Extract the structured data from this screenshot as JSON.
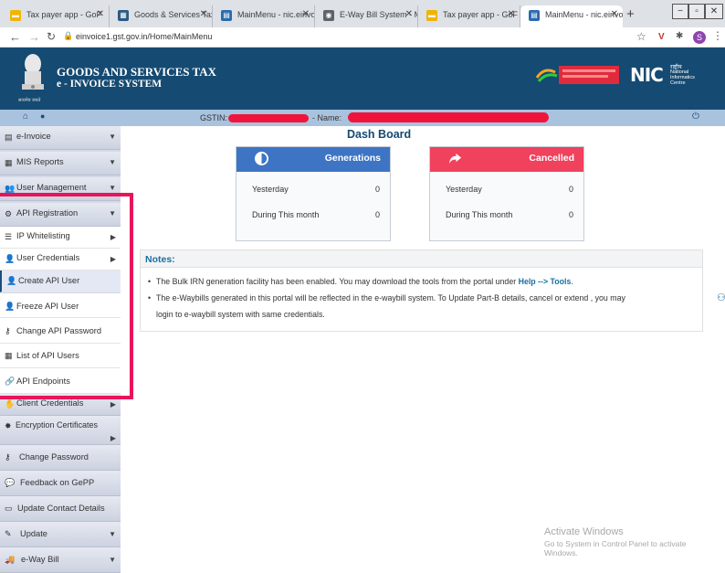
{
  "browser": {
    "tabs": [
      {
        "label": "Tax payer app - GoF",
        "icon": "folder-icon",
        "color": "#f1b400"
      },
      {
        "label": "Goods & Services Tax",
        "icon": "gst-favicon",
        "color": "#2b5a83"
      },
      {
        "label": "MainMenu - nic.einvo",
        "icon": "page-icon",
        "color": "#2b6aaf"
      },
      {
        "label": "E-Way Bill System - M",
        "icon": "globe-icon",
        "color": "#5f6368"
      },
      {
        "label": "Tax payer app - GoF",
        "icon": "folder-icon",
        "color": "#f1b400"
      },
      {
        "label": "MainMenu - nic.einvo",
        "icon": "page-icon",
        "color": "#2b6aaf"
      }
    ],
    "new_tab": "+",
    "url": "einvoice1.gst.gov.in/Home/MainMenu",
    "profile_initial": "S"
  },
  "header": {
    "title_line1": "GOODS AND SERVICES TAX",
    "title_line2": "e - INVOICE SYSTEM",
    "emblem_caption": "सत्यमेव जयते",
    "nic_hindi": "राष्ट्रीय",
    "nic_line1": "National",
    "nic_line2": "Informatics",
    "nic_line3": "Centre"
  },
  "gstin_bar": {
    "gstin_label": "GSTIN:",
    "name_label": "- Name:"
  },
  "sidebar": {
    "items": [
      {
        "label": "e-Invoice",
        "icon": "file-icon"
      },
      {
        "label": "MIS Reports",
        "icon": "report-icon"
      },
      {
        "label": "User Management",
        "icon": "users-icon"
      },
      {
        "label": "API Registration",
        "icon": "gear-icon"
      },
      {
        "label": "IP Whitelisting",
        "icon": "list-icon"
      },
      {
        "label": "User Credentials",
        "icon": "user-key-icon"
      },
      {
        "label": "Create API User",
        "icon": "user-plus-icon"
      },
      {
        "label": "Freeze API User",
        "icon": "user-lock-icon"
      },
      {
        "label": "Change API Password",
        "icon": "key-icon"
      },
      {
        "label": "List of API Users",
        "icon": "table-icon"
      },
      {
        "label": "API Endpoints",
        "icon": "link-icon"
      },
      {
        "label": "Client Credentials",
        "icon": "handshake-icon"
      },
      {
        "label": "Encryption Certificates",
        "icon": "certificate-icon"
      },
      {
        "label": "Change Password",
        "icon": "key-icon"
      },
      {
        "label": "Feedback on GePP",
        "icon": "comments-icon"
      },
      {
        "label": "Update Contact Details",
        "icon": "id-card-icon"
      },
      {
        "label": "Update",
        "icon": "edit-icon"
      },
      {
        "label": "e-Way Bill",
        "icon": "truck-icon"
      }
    ]
  },
  "dashboard": {
    "title": "Dash Board",
    "generations": {
      "title": "Generations",
      "yesterday_label": "Yesterday",
      "yesterday_value": "0",
      "month_label": "During This month",
      "month_value": "0",
      "color": "#3e74c4"
    },
    "cancelled": {
      "title": "Cancelled",
      "yesterday_label": "Yesterday",
      "yesterday_value": "0",
      "month_label": "During This month",
      "month_value": "0",
      "color": "#f0415d"
    }
  },
  "notes": {
    "title": "Notes:",
    "note1_text": "The Bulk IRN generation facility has been enabled. You may download the tools from the portal under ",
    "note1_link": "Help --> Tools",
    "note1_end": ".",
    "note2_line1": "The e-Waybills generated in this portal will be reflected in the e-waybill system. To Update Part-B details, cancel or extend , you may",
    "note2_line2": "login to e-waybill system with same credentials."
  },
  "watermark": {
    "line1": "Activate Windows",
    "line2": "Go to System in Control Panel to activate",
    "line3": "Windows."
  }
}
